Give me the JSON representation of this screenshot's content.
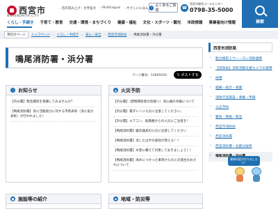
{
  "header": {
    "logo_text": "西宮市",
    "logo_sub": "NISHINOMIYA CITY",
    "util_links": [
      "音声読み上げ・文字拡大",
      "Multilingual",
      "やさしいにほんご"
    ],
    "faq": "よくあるご質問",
    "call_label": "西宮市総合コールセンター",
    "call_number": "0798-35-5000",
    "search_label": "検索",
    "nav": [
      "くらし・手続き",
      "子育て・教育",
      "交通・環境・まちづくり",
      "健康・福祉",
      "文化・スポーツ・観光",
      "市政情報",
      "事業者向け情報"
    ]
  },
  "breadcrumb": {
    "here_label": "現在のページ",
    "items": [
      "トップページ",
      "くらし・手続き",
      "安心・安全",
      "西宮市消防局"
    ],
    "current": "鳴尾消防署・浜分署"
  },
  "page": {
    "title": "鳴尾消防署・浜分署",
    "page_number": "ページ番号：14669430",
    "share_label": "ポストする"
  },
  "panels": {
    "news": {
      "title": "お知らせ",
      "items": [
        "【浜分署】救急講習を受講してみませんか？",
        "【鳴尾消防署】消火活動協力に対する市民表彰（消火協力表彰）が行われました！"
      ]
    },
    "fire": {
      "title": "火災予防",
      "items": [
        "【浜分署】（建物関係者の皆様へ）消火器の点検について",
        "【浜分署】電子レンジ火災に注意してください。",
        "【浜分署】エアコン、扇風機からの火災にご注意を！",
        "【鳴尾消防署】暖房器具の火災に注意してください",
        "【鳴尾消防署】消したはずの吸殻が燃える！？",
        "【鳴尾消防署】水害に備えて対策しておきましょう！！",
        "【鳴尾消防署】海水につかった車両からの火災発生のおそれについて"
      ]
    },
    "facilities": {
      "title": "施設等の紹介"
    },
    "area": {
      "title": "地域・防災等"
    }
  },
  "sidebar": {
    "heading": "西宮市消防局",
    "items": [
      "能力検定１ウー・ロン消防連携",
      "【消防局】消防活動支援カメラの運用",
      "採用",
      "組織・統計・事業",
      "消防庁舎施設・事業・申請",
      "火災予防",
      "警防・救助・救急",
      "西宮市消防局",
      "西宮消防署",
      "西宮消防署・北部分駐所",
      "鳴尾消防署・浜分署"
    ],
    "current_index": 10,
    "help_text": "質問内容がかりましたら？"
  }
}
